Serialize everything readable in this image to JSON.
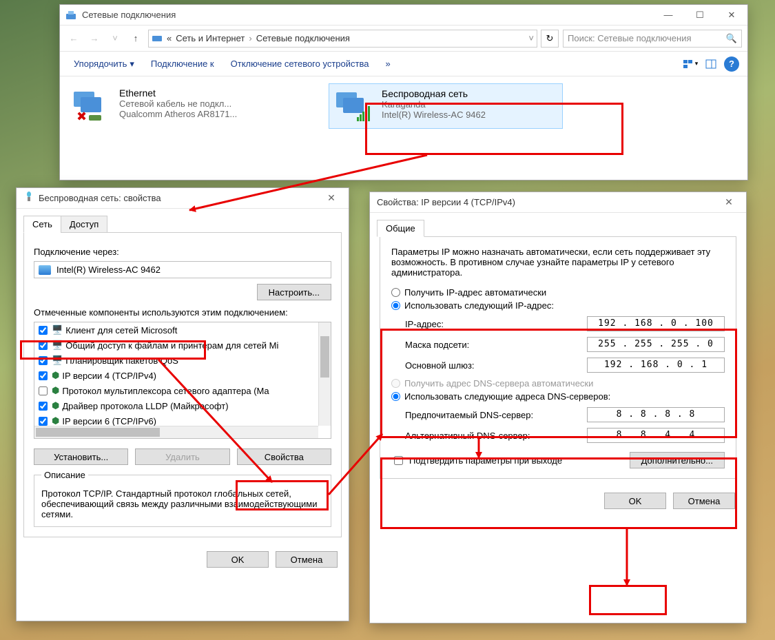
{
  "explorer": {
    "title": "Сетевые подключения",
    "breadcrumb": {
      "root_prefix": "«",
      "seg1": "Сеть и Интернет",
      "seg2": "Сетевые подключения"
    },
    "search_placeholder": "Поиск: Сетевые подключения",
    "toolbar": {
      "organize": "Упорядочить",
      "connect": "Подключение к",
      "disable": "Отключение сетевого устройства",
      "more": "»"
    },
    "items": {
      "ethernet": {
        "name": "Ethernet",
        "status": "Сетевой кабель не подкл...",
        "driver": "Qualcomm Atheros AR8171..."
      },
      "wifi": {
        "name": "Беспроводная сеть",
        "status": "Karaganda",
        "driver": "Intel(R) Wireless-AC 9462"
      }
    }
  },
  "props": {
    "title": "Беспроводная сеть: свойства",
    "tabs": {
      "network": "Сеть",
      "access": "Доступ"
    },
    "connect_via": "Подключение через:",
    "adapter": "Intel(R) Wireless-AC 9462",
    "configure": "Настроить...",
    "components_lbl": "Отмеченные компоненты используются этим подключением:",
    "components": [
      {
        "checked": true,
        "label": "Клиент для сетей Microsoft"
      },
      {
        "checked": true,
        "label": "Общий доступ к файлам и принтерам для сетей Mi"
      },
      {
        "checked": true,
        "label": "Планировщик пакетов QoS"
      },
      {
        "checked": true,
        "label": "IP версии 4 (TCP/IPv4)"
      },
      {
        "checked": false,
        "label": "Протокол мультиплексора сетевого адаптера (Ma"
      },
      {
        "checked": true,
        "label": "Драйвер протокола LLDP (Майкрософт)"
      },
      {
        "checked": true,
        "label": "IP версии 6 (TCP/IPv6)"
      }
    ],
    "install": "Установить...",
    "remove": "Удалить",
    "properties": "Свойства",
    "desc_legend": "Описание",
    "desc_text": "Протокол TCP/IP. Стандартный протокол глобальных сетей, обеспечивающий связь между различными взаимодействующими сетями.",
    "ok": "OK",
    "cancel": "Отмена"
  },
  "ip": {
    "title": "Свойства: IP версии 4 (TCP/IPv4)",
    "tab_general": "Общие",
    "intro": "Параметры IP можно назначать автоматически, если сеть поддерживает эту возможность. В противном случае узнайте параметры IP у сетевого администратора.",
    "obtain_auto": "Получить IP-адрес автоматически",
    "use_following_ip": "Использовать следующий IP-адрес:",
    "labels": {
      "ip": "IP-адрес:",
      "mask": "Маска подсети:",
      "gw": "Основной шлюз:"
    },
    "values": {
      "ip": "192 . 168 .  0  . 100",
      "mask": "255 . 255 . 255 .  0",
      "gw": "192 . 168 .  0  .  1"
    },
    "obtain_dns_auto": "Получить адрес DNS-сервера автоматически",
    "use_following_dns": "Использовать следующие адреса DNS-серверов:",
    "dns_labels": {
      "pref": "Предпочитаемый DNS-сервер:",
      "alt": "Альтернативный DNS-сервер:"
    },
    "dns_values": {
      "pref": "8  .  8  .  8  .  8",
      "alt": "8  .  8  .  4  .  4"
    },
    "validate": "Подтвердить параметры при выходе",
    "advanced": "Дополнительно...",
    "ok": "OK",
    "cancel": "Отмена"
  }
}
